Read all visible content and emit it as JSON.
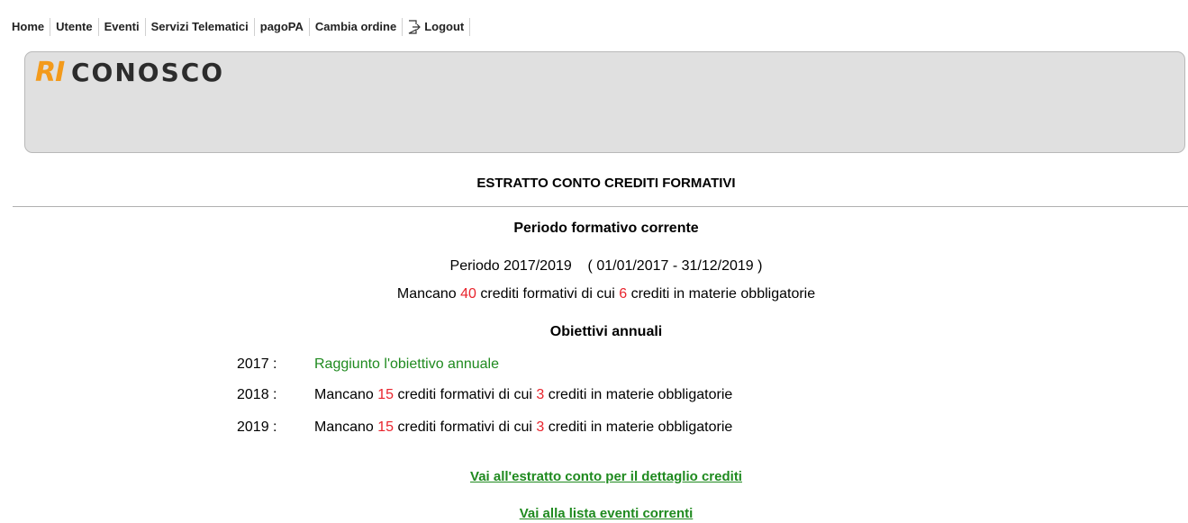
{
  "nav": {
    "items": [
      {
        "label": "Home"
      },
      {
        "label": "Utente"
      },
      {
        "label": "Eventi"
      },
      {
        "label": "Servizi Telematici"
      },
      {
        "label": "pagoPA"
      },
      {
        "label": "Cambia ordine"
      }
    ],
    "logout_label": "Logout",
    "logout_icon": "logout-icon"
  },
  "brand": {
    "logo_prefix": "RI",
    "logo_suffix": "CONOSCO",
    "prefix_color": "#f39a1b",
    "suffix_color": "#2c2c2c"
  },
  "page": {
    "title": "ESTRATTO CONTO CREDITI FORMATIVI",
    "current_period_heading": "Periodo formativo corrente",
    "period_label": "Periodo 2017/2019",
    "period_range": "( 01/01/2017 - 31/12/2019 )",
    "missing": {
      "prefix": "Mancano",
      "credits": "40",
      "middle": "crediti formativi di cui",
      "mandatory": "6",
      "suffix": "crediti in materie obbligatorie"
    },
    "annual_goals_heading": "Obiettivi annuali",
    "goals": [
      {
        "year": "2017 :",
        "status": "Raggiunto l'obiettivo annuale"
      },
      {
        "year": "2018 :",
        "prefix": "Mancano",
        "credits": "15",
        "middle": "crediti formativi di cui",
        "mandatory": "3",
        "suffix": "crediti in materie obbligatorie"
      },
      {
        "year": "2019 :",
        "prefix": "Mancano",
        "credits": "15",
        "middle": "crediti formativi di cui",
        "mandatory": "3",
        "suffix": "crediti in materie obbligatorie"
      }
    ],
    "links": {
      "statement_detail": "Vai all'estratto conto per il dettaglio crediti",
      "current_events": "Vai alla lista eventi correnti"
    }
  },
  "colors": {
    "accent_red": "#e8242d",
    "accent_green": "#1f8a1f"
  }
}
